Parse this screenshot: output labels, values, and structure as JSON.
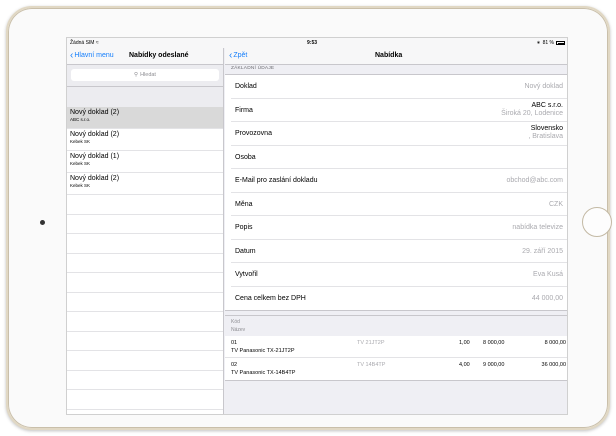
{
  "status": {
    "carrier": "Žádná SIM",
    "time": "9:53",
    "battery": "81 %"
  },
  "left": {
    "back_label": "Hlavní menu",
    "title": "Nabídky odeslané",
    "search_placeholder": "Hledat",
    "documents": [
      {
        "title": "Nový doklad (2)",
        "subtitle": "ABC s.r.o."
      },
      {
        "title": "Nový doklad (2)",
        "subtitle": "Kebek SK"
      },
      {
        "title": "Nový doklad (1)",
        "subtitle": "Kebek SK"
      },
      {
        "title": "Nový doklad (2)",
        "subtitle": "Kebek SK"
      }
    ]
  },
  "right": {
    "back_label": "Zpět",
    "title": "Nabídka",
    "section_header": "ZÁKLADNÍ ÚDAJE",
    "fields": {
      "doklad": {
        "label": "Doklad",
        "value": "Nový doklad"
      },
      "firma": {
        "label": "Firma",
        "value": "ABC s.r.o.",
        "value2": "Široká 20, Lodenice"
      },
      "provozovna": {
        "label": "Provozovna",
        "value": "Slovensko",
        "value2": ", Bratislava"
      },
      "osoba": {
        "label": "Osoba",
        "value": ""
      },
      "email": {
        "label": "E-Mail pro zaslání dokladu",
        "value": "obchod@abc.com"
      },
      "mena": {
        "label": "Měna",
        "value": "CZK"
      },
      "popis": {
        "label": "Popis",
        "value": "nabídka televize"
      },
      "datum": {
        "label": "Datum",
        "value": "29. září 2015"
      },
      "vytvoril": {
        "label": "Vytvořil",
        "value": "Eva Kusá"
      },
      "cena": {
        "label": "Cena celkem bez DPH",
        "value": "44 000,00"
      }
    },
    "items_header": {
      "code": "Kód",
      "name": "Název"
    },
    "items": [
      {
        "code": "01",
        "name": "TV Panasonic TX-21JT2P",
        "ean": "TV 21JT2P",
        "qty": "1,00",
        "price": "8 000,00",
        "total": "8 000,00"
      },
      {
        "code": "02",
        "name": "TV Panasonic TX-14B4TP",
        "ean": "TV 14B4TP",
        "qty": "4,00",
        "price": "9 000,00",
        "total": "36 000,00"
      }
    ]
  },
  "colors": {
    "accent": "#147efb",
    "background": "#efeff4",
    "selected_row": "#d9d9d9",
    "secondary_text": "#aaaaaf"
  }
}
